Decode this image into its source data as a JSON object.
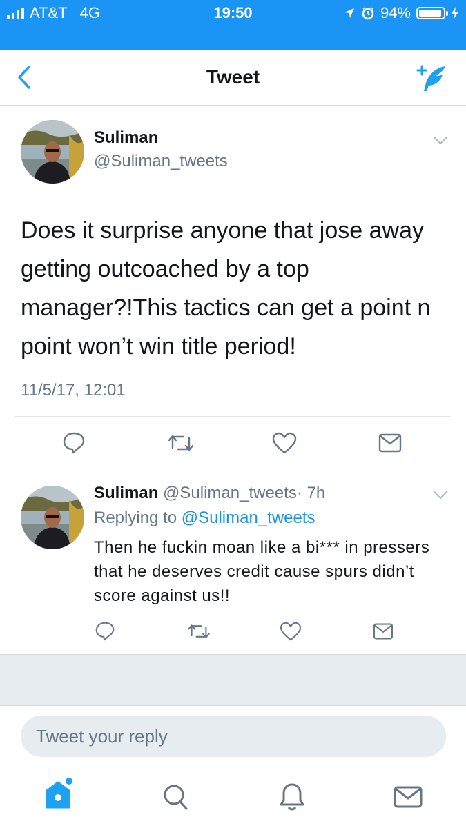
{
  "status_bar": {
    "carrier": "AT&T",
    "network": "4G",
    "time": "19:50",
    "battery": "94%",
    "battery_level": 0.94,
    "background": "#1b95f5"
  },
  "nav": {
    "title": "Tweet",
    "back_icon": "chevron-left-icon",
    "compose_icon": "compose-feather-icon",
    "accent": "#1da1f2"
  },
  "main_tweet": {
    "name": "Suliman",
    "handle": "@Suliman_tweets",
    "text": "Does it surprise anyone that jose away getting outcoached by a top manager?!This tactics can get a point n point won’t win title period!",
    "timestamp": "11/5/17, 12:01",
    "actions": [
      "reply-icon",
      "retweet-icon",
      "like-icon",
      "direct-message-icon"
    ]
  },
  "reply_tweet": {
    "name": "Suliman",
    "handle": "@Suliman_tweets",
    "age": "· 7h",
    "replying_prefix": "Replying to",
    "replying_handle": "@Suliman_tweets",
    "text": "Then he fuckin moan like a bi*** in pressers that he deserves credit cause spurs didn’t score against us!!",
    "actions": [
      "reply-icon",
      "retweet-icon",
      "like-icon",
      "direct-message-icon"
    ]
  },
  "composer": {
    "placeholder": "Tweet your reply"
  },
  "tab_bar": {
    "items": [
      "home-icon",
      "search-icon",
      "notifications-icon",
      "messages-icon"
    ],
    "active": "home-icon"
  }
}
